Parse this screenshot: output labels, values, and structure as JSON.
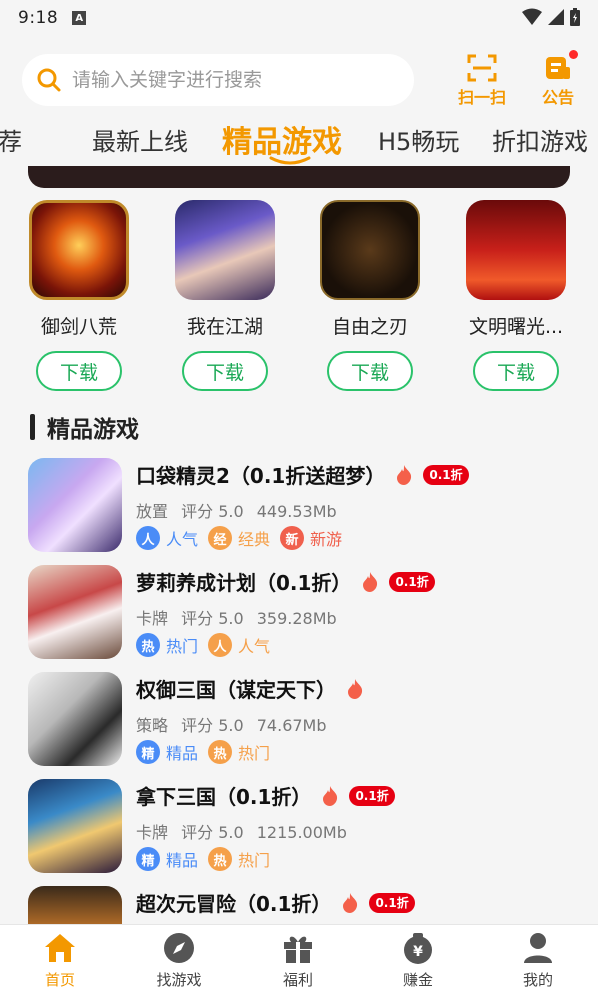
{
  "status_bar": {
    "time": "9:18",
    "notification_badge": "A"
  },
  "search": {
    "placeholder": "请输入关键字进行搜索"
  },
  "top_actions": {
    "scan_label": "扫一扫",
    "notice_label": "公告"
  },
  "tabs": [
    {
      "label": "推荐"
    },
    {
      "label": "最新上线"
    },
    {
      "label": "精品游戏",
      "active": true
    },
    {
      "label": "H5畅玩"
    },
    {
      "label": "折扣游戏"
    }
  ],
  "hot_games": [
    {
      "name": "御剑八荒",
      "button": "下载"
    },
    {
      "name": "我在江湖",
      "button": "下载"
    },
    {
      "name": "自由之刃",
      "button": "下载"
    },
    {
      "name": "文明曙光...",
      "button": "下载"
    }
  ],
  "section": {
    "title": "精品游戏"
  },
  "games": [
    {
      "title": "口袋精灵2（0.1折送超梦）",
      "category": "放置",
      "rating": "评分 5.0",
      "size": "449.53Mb",
      "hot": true,
      "discount": "0.1折",
      "tags": [
        {
          "icon": "人",
          "text": "人气",
          "color": "#4a8cf7"
        },
        {
          "icon": "经",
          "text": "经典",
          "color": "#f5a04a"
        },
        {
          "icon": "新",
          "text": "新游",
          "color": "#f0604d"
        }
      ]
    },
    {
      "title": "萝莉养成计划（0.1折）",
      "category": "卡牌",
      "rating": "评分 5.0",
      "size": "359.28Mb",
      "hot": true,
      "discount": "0.1折",
      "tags": [
        {
          "icon": "热",
          "text": "热门",
          "color": "#4a8cf7"
        },
        {
          "icon": "人",
          "text": "人气",
          "color": "#f5a04a"
        }
      ]
    },
    {
      "title": "权御三国（谋定天下）",
      "category": "策略",
      "rating": "评分 5.0",
      "size": "74.67Mb",
      "hot": true,
      "discount": "",
      "tags": [
        {
          "icon": "精",
          "text": "精品",
          "color": "#4a8cf7"
        },
        {
          "icon": "热",
          "text": "热门",
          "color": "#f5a04a"
        }
      ]
    },
    {
      "title": "拿下三国（0.1折）",
      "category": "卡牌",
      "rating": "评分 5.0",
      "size": "1215.00Mb",
      "hot": true,
      "discount": "0.1折",
      "tags": [
        {
          "icon": "精",
          "text": "精品",
          "color": "#4a8cf7"
        },
        {
          "icon": "热",
          "text": "热门",
          "color": "#f5a04a"
        }
      ]
    },
    {
      "title": "超次元冒险（0.1折）",
      "category": "",
      "rating": "",
      "size": "",
      "hot": true,
      "discount": "0.1折",
      "tags": []
    }
  ],
  "bottom_nav": [
    {
      "label": "首页",
      "icon": "home-icon",
      "active": true
    },
    {
      "label": "找游戏",
      "icon": "compass-icon"
    },
    {
      "label": "福利",
      "icon": "gift-icon"
    },
    {
      "label": "赚金",
      "icon": "money-bag-icon"
    },
    {
      "label": "我的",
      "icon": "user-icon"
    }
  ],
  "colors": {
    "accent": "#f39800",
    "download_green": "#2ac26a",
    "discount_red": "#e60012"
  }
}
